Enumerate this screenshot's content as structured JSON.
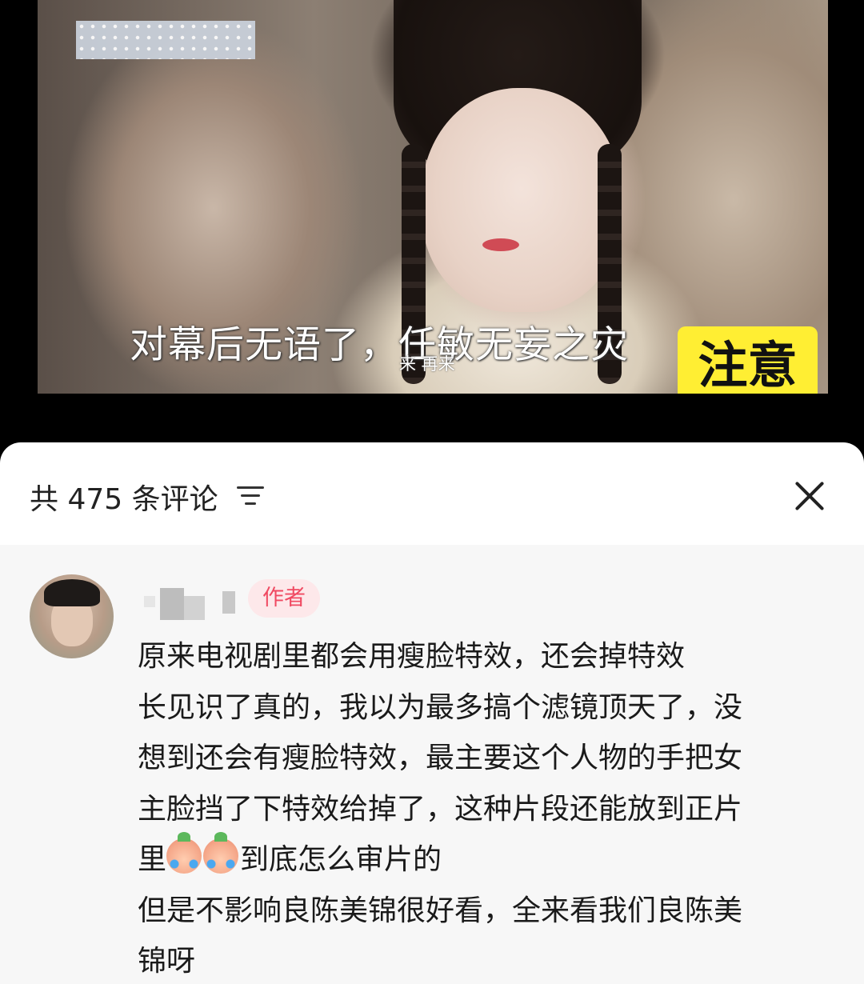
{
  "video": {
    "subtitle": "对幕后无语了，任敏无妄之灾",
    "small_caption": "来 再来",
    "sticker_text": "注意"
  },
  "comments_panel": {
    "count_label": "共 475 条评论",
    "filter_icon": "sort-filter-icon",
    "close_icon": "close-icon"
  },
  "comment": {
    "author_badge": "作者",
    "lines": [
      "原来电视剧里都会用瘦脸特效，还会掉特效",
      "长见识了真的，我以为最多搞个滤镜顶天了，没",
      "想到还会有瘦脸特效，最主要这个人物的手把女",
      "主脸挡了下特效给掉了，这种片段还能放到正片",
      "到底怎么审片的",
      "但是不影响良陈美锦很好看，全来看我们良陈美",
      "锦呀"
    ],
    "line5_prefix": "里",
    "emoji_icon": "crying-emoji-icon"
  }
}
